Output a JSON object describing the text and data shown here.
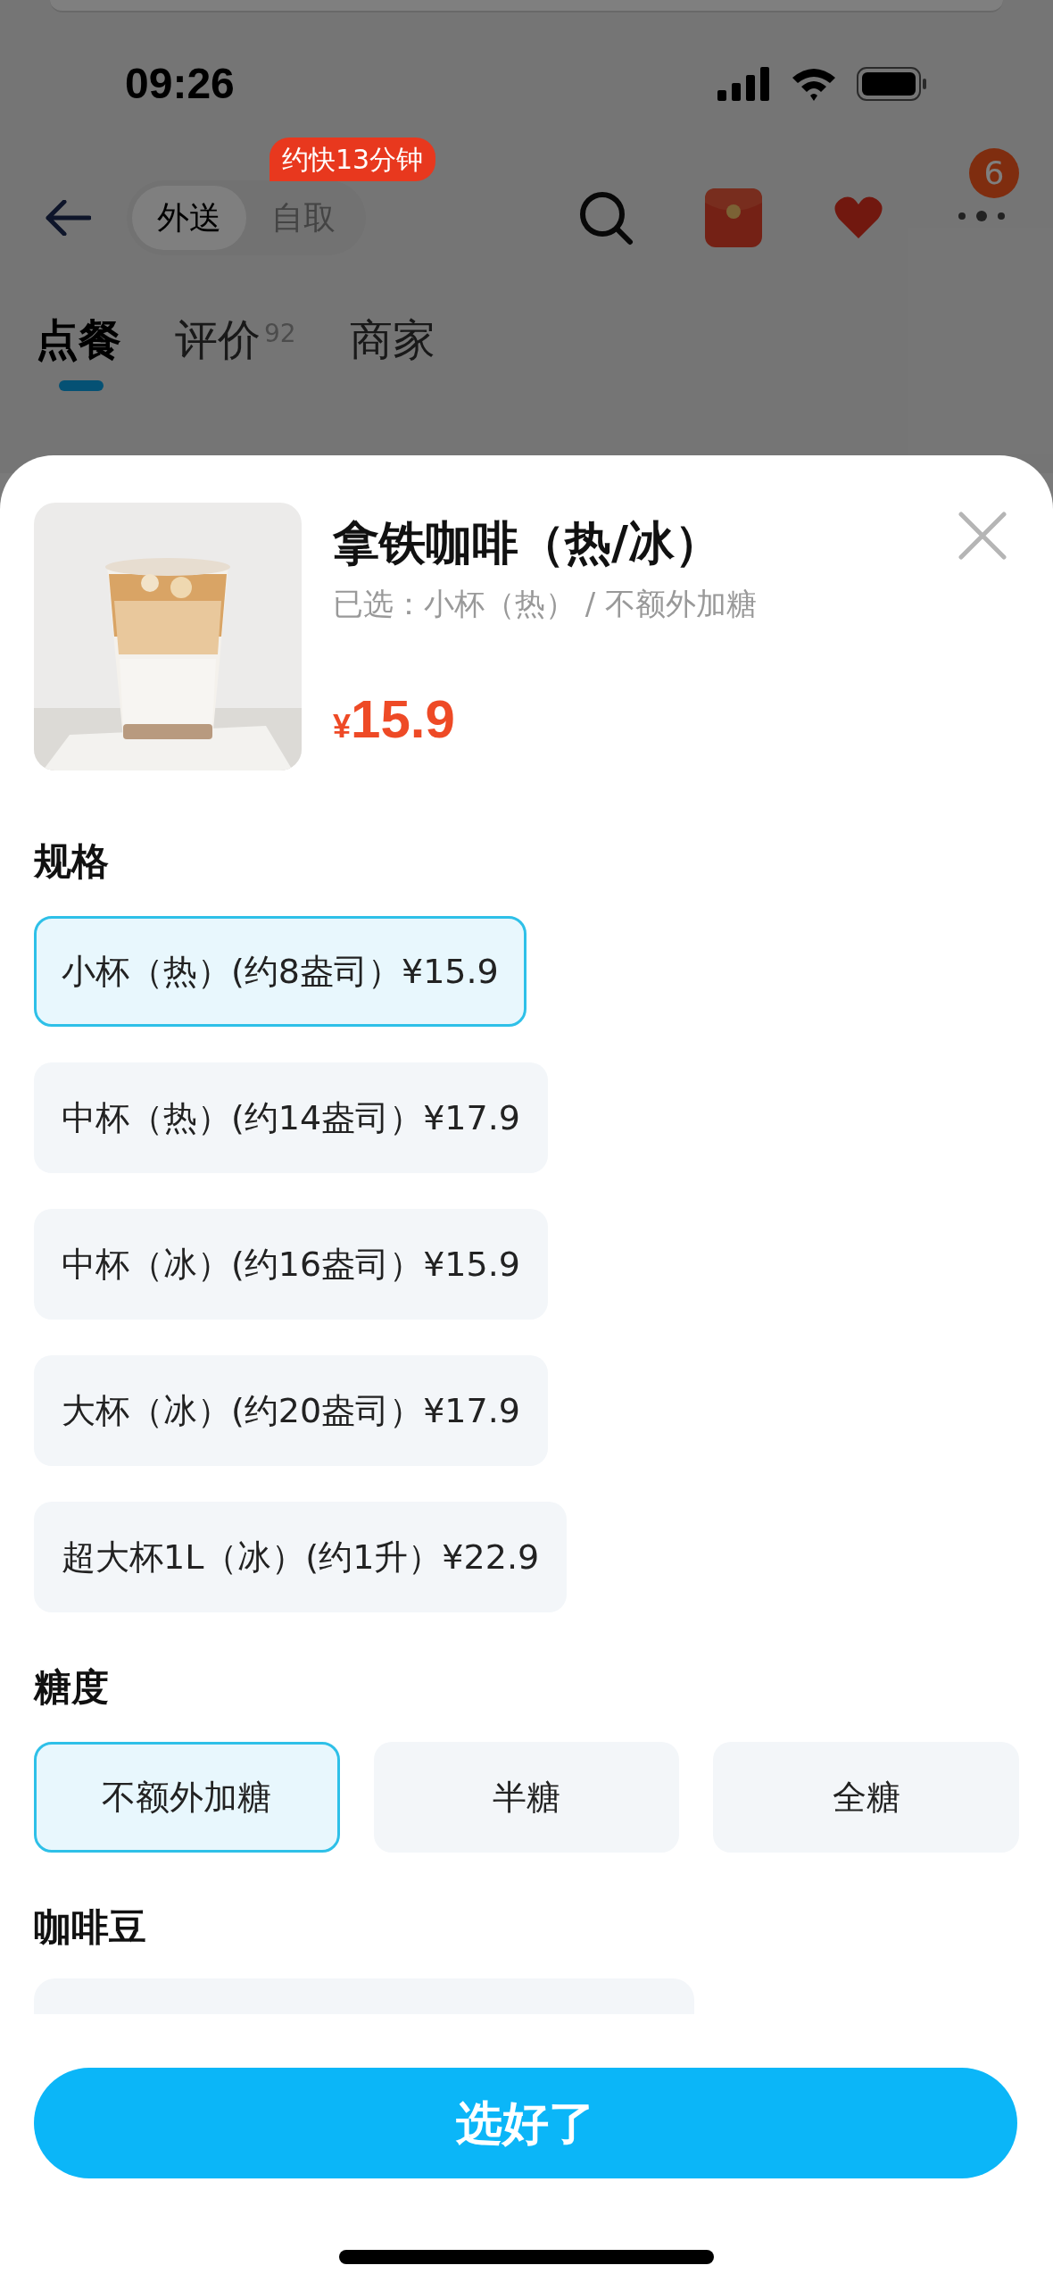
{
  "status_bar": {
    "time": "09:26"
  },
  "nav": {
    "modes": [
      {
        "label": "外送",
        "selected": true
      },
      {
        "label": "自取",
        "selected": false
      }
    ],
    "mode_badge": "约快13分钟",
    "more_badge": "6"
  },
  "tabs": [
    {
      "label": "点餐",
      "selected": true
    },
    {
      "label": "评价",
      "selected": false,
      "count": "92"
    },
    {
      "label": "商家",
      "selected": false
    }
  ],
  "product": {
    "title": "拿铁咖啡（热/冰）",
    "selection": "已选：小杯（热） / 不额外加糖",
    "currency": "¥",
    "price": "15.9"
  },
  "sections": [
    {
      "title": "规格",
      "kind": "list",
      "options": [
        {
          "label": "小杯（热）(约8盎司）¥15.9",
          "selected": true
        },
        {
          "label": "中杯（热）(约14盎司）¥17.9",
          "selected": false
        },
        {
          "label": "中杯（冰）(约16盎司）¥15.9",
          "selected": false
        },
        {
          "label": "大杯（冰）(约20盎司）¥17.9",
          "selected": false
        },
        {
          "label": "超大杯1L（冰）(约1升）¥22.9",
          "selected": false
        }
      ]
    },
    {
      "title": "糖度",
      "kind": "grid",
      "options": [
        {
          "label": "不额外加糖",
          "selected": true
        },
        {
          "label": "半糖",
          "selected": false
        },
        {
          "label": "全糖",
          "selected": false
        }
      ]
    },
    {
      "title": "咖啡豆",
      "kind": "partial"
    }
  ],
  "confirm_button": "选好了"
}
